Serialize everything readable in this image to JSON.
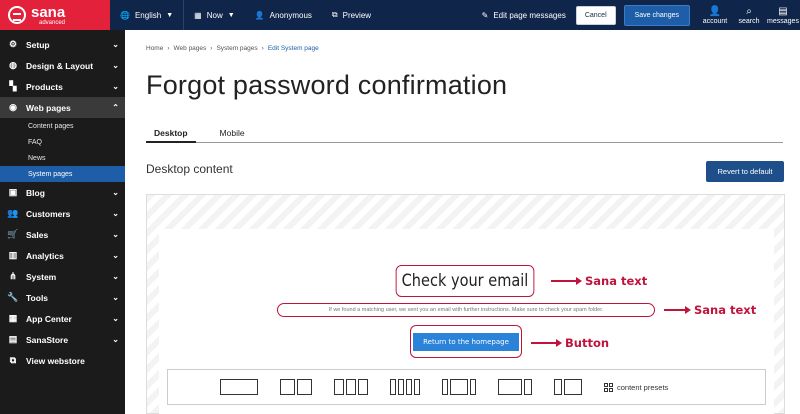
{
  "brand": {
    "name": "sana",
    "sub": "advanced"
  },
  "topbar": {
    "language": "English",
    "date": "Now",
    "user": "Anonymous",
    "preview": "Preview",
    "edit_messages": "Edit page messages",
    "cancel": "Cancel",
    "save": "Save changes",
    "account": "account",
    "search": "search",
    "messages": "messages"
  },
  "sidebar": {
    "items": [
      {
        "label": "Setup",
        "icon": "gear-icon"
      },
      {
        "label": "Design & Layout",
        "icon": "palette-icon"
      },
      {
        "label": "Products",
        "icon": "products-icon"
      },
      {
        "label": "Web pages",
        "icon": "globe-icon"
      },
      {
        "label": "Blog",
        "icon": "blog-icon"
      },
      {
        "label": "Customers",
        "icon": "customers-icon"
      },
      {
        "label": "Sales",
        "icon": "cart-icon"
      },
      {
        "label": "Analytics",
        "icon": "analytics-icon"
      },
      {
        "label": "System",
        "icon": "system-icon"
      },
      {
        "label": "Tools",
        "icon": "wrench-icon"
      },
      {
        "label": "App Center",
        "icon": "apps-icon"
      },
      {
        "label": "SanaStore",
        "icon": "store-icon"
      },
      {
        "label": "View webstore",
        "icon": "external-link-icon"
      }
    ],
    "sub_items": [
      "Content pages",
      "FAQ",
      "News",
      "System pages"
    ]
  },
  "breadcrumb": [
    "Home",
    "Web pages",
    "System pages",
    "Edit System page"
  ],
  "page_title": "Forgot password confirmation",
  "tabs": [
    "Desktop",
    "Mobile"
  ],
  "section_title": "Desktop content",
  "revert_label": "Revert to default",
  "content": {
    "heading": "Check your email",
    "paragraph": "If we found a matching user, we sent you an email with further instructions. Make sure to check your spam folder.",
    "button": "Return to the homepage"
  },
  "annotations": [
    "Sana text",
    "Sana text",
    "Button"
  ],
  "presets_label": "content presets",
  "colors": {
    "topbar": "#10254a",
    "brand": "#e3213b",
    "accent": "#1e5ea8",
    "annotation": "#c0143c"
  }
}
